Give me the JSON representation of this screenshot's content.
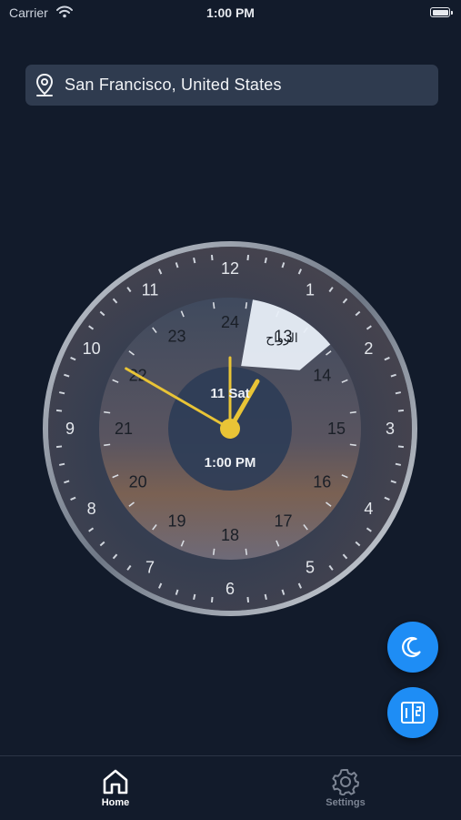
{
  "status_bar": {
    "carrier": "Carrier",
    "time": "1:00 PM"
  },
  "location": {
    "text": "San Francisco, United States",
    "icon": "map-pin-icon"
  },
  "clock": {
    "date_label": "11 Sat",
    "time_label": "1:00 PM",
    "segment_label": "الرواح",
    "outer_numbers": [
      "12",
      "1",
      "2",
      "3",
      "4",
      "5",
      "6",
      "7",
      "8",
      "9",
      "10",
      "11"
    ],
    "inner_numbers": [
      "24",
      "13",
      "14",
      "15",
      "16",
      "17",
      "18",
      "19",
      "20",
      "21",
      "22",
      "23"
    ],
    "hands": {
      "hour": 13,
      "minute": 0,
      "day_hour24": 20
    },
    "colors": {
      "hand": "#e9c436",
      "segment": "#e8eef7",
      "inner_disc": "#2e3d57"
    }
  },
  "fabs": {
    "night": "moon-icon",
    "calendar": "calendar-icon"
  },
  "tabs": [
    {
      "label": "Home",
      "icon": "home-icon",
      "active": true
    },
    {
      "label": "Settings",
      "icon": "gear-icon",
      "active": false
    }
  ],
  "colors": {
    "background": "#121b2b",
    "accent": "#1e8df5",
    "hand": "#e9c436"
  }
}
